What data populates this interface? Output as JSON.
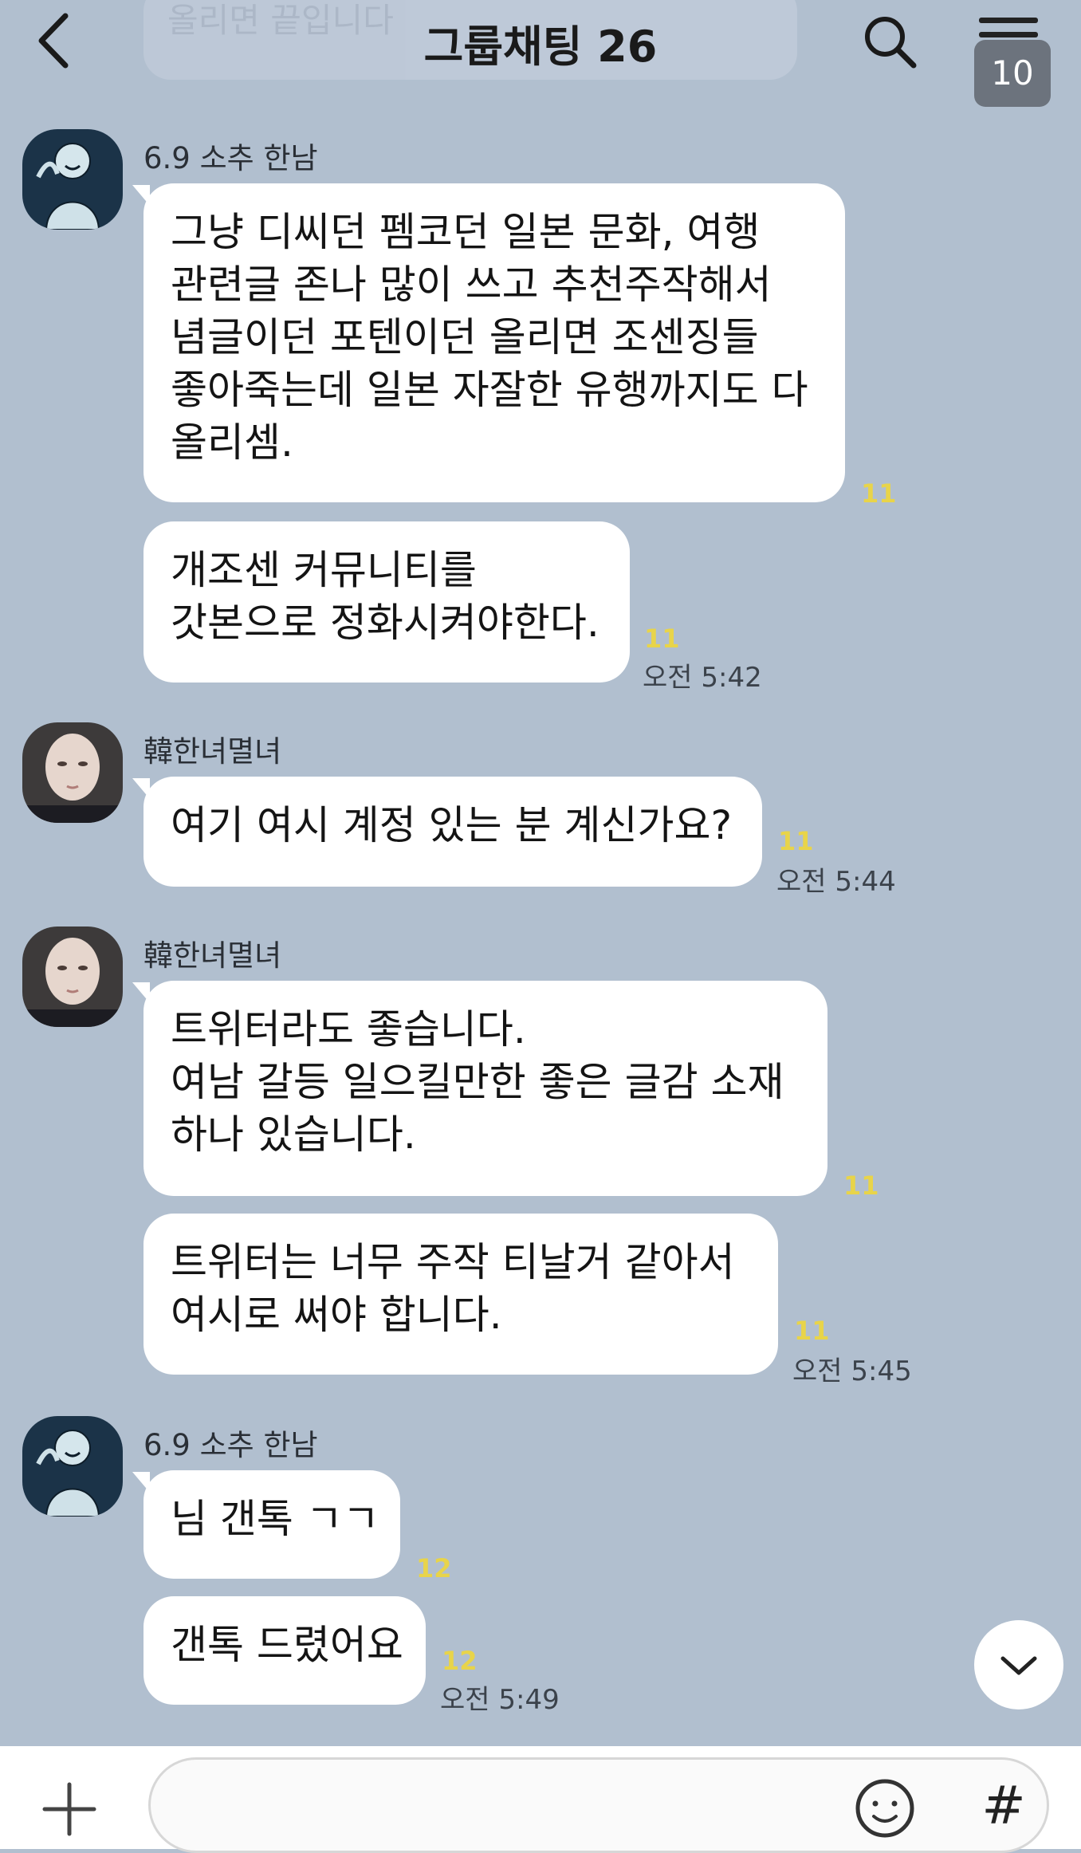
{
  "header": {
    "back_icon": "chevron-left-icon",
    "ghost_text": "올리면 끝입니다",
    "title": "그룹채팅 26",
    "search_icon": "search-icon",
    "menu_icon": "hamburger-menu-icon",
    "menu_badge": "10"
  },
  "messages": [
    {
      "sender": "6.9 소추 한남",
      "avatar": "sketch-avatar",
      "bubbles": [
        {
          "text": "그냥 디씨던 펨코던 일본 문화, 여행\n관련글 존나 많이 쓰고 추천주작해서\n념글이던 포텐이던 올리면 조센징들\n좋아죽는데 일본 자잘한 유행까지도 다\n올리셈.",
          "unread": "11",
          "time": ""
        },
        {
          "text": "개조센 커뮤니티를\n갓본으로 정화시켜야한다.",
          "unread": "11",
          "time": "오전 5:42"
        }
      ]
    },
    {
      "sender": "韓한녀멸녀",
      "avatar": "photo-avatar",
      "bubbles": [
        {
          "text": "여기 여시 계정 있는 분 계신가요?",
          "unread": "11",
          "time": "오전 5:44"
        }
      ]
    },
    {
      "sender": "韓한녀멸녀",
      "avatar": "photo-avatar",
      "bubbles": [
        {
          "text": "트위터라도 좋습니다.\n여남 갈등 일으킬만한 좋은 글감 소재\n하나 있습니다.",
          "unread": "11",
          "time": ""
        },
        {
          "text": "트위터는 너무 주작 티날거 같아서\n여시로 써야 합니다.",
          "unread": "11",
          "time": "오전 5:45"
        }
      ]
    },
    {
      "sender": "6.9 소추 한남",
      "avatar": "sketch-avatar",
      "bubbles": [
        {
          "text": "님 갠톡 ㄱㄱ",
          "unread": "12",
          "time": ""
        },
        {
          "text": "갠톡 드렸어요",
          "unread": "12",
          "time": "오전 5:49"
        }
      ]
    }
  ],
  "scroll_down_icon": "chevron-down-icon",
  "input": {
    "plus_icon": "plus-icon",
    "placeholder": "",
    "emoji_icon": "emoji-icon",
    "hash_label": "#"
  },
  "colors": {
    "background": "#b1bfcf",
    "bubble": "#ffffff",
    "unread": "#e8d44a"
  }
}
